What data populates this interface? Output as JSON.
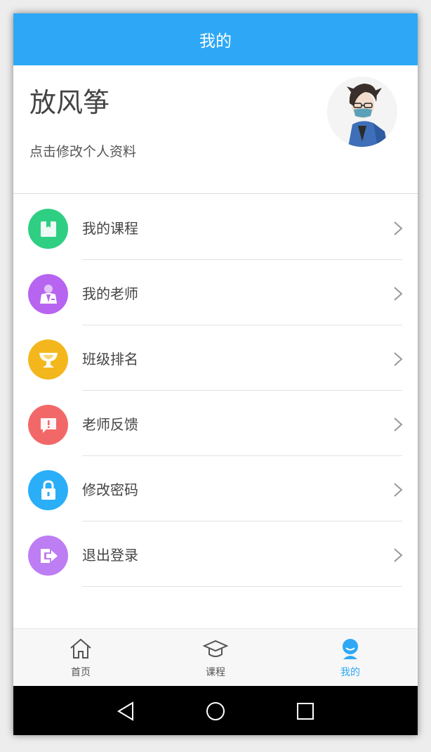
{
  "header": {
    "title": "我的"
  },
  "profile": {
    "name": "放风筝",
    "edit_hint": "点击修改个人资料"
  },
  "menu": {
    "items": [
      {
        "label": "我的课程",
        "icon": "book-icon",
        "color": "#2fcf83"
      },
      {
        "label": "我的老师",
        "icon": "teacher-icon",
        "color": "#b765f0"
      },
      {
        "label": "班级排名",
        "icon": "trophy-icon",
        "color": "#f3b71d"
      },
      {
        "label": "老师反馈",
        "icon": "feedback-icon",
        "color": "#f26868"
      },
      {
        "label": "修改密码",
        "icon": "lock-icon",
        "color": "#2aaef7"
      },
      {
        "label": "退出登录",
        "icon": "logout-icon",
        "color": "#bd7df3"
      }
    ]
  },
  "tabbar": {
    "tabs": [
      {
        "label": "首页",
        "icon": "home-icon"
      },
      {
        "label": "课程",
        "icon": "graduation-cap-icon"
      },
      {
        "label": "我的",
        "icon": "user-icon",
        "active": true
      }
    ],
    "active_color": "#2ea8f6"
  },
  "system_nav": {
    "buttons": [
      "back-icon",
      "home-circle-icon",
      "recents-icon"
    ]
  }
}
